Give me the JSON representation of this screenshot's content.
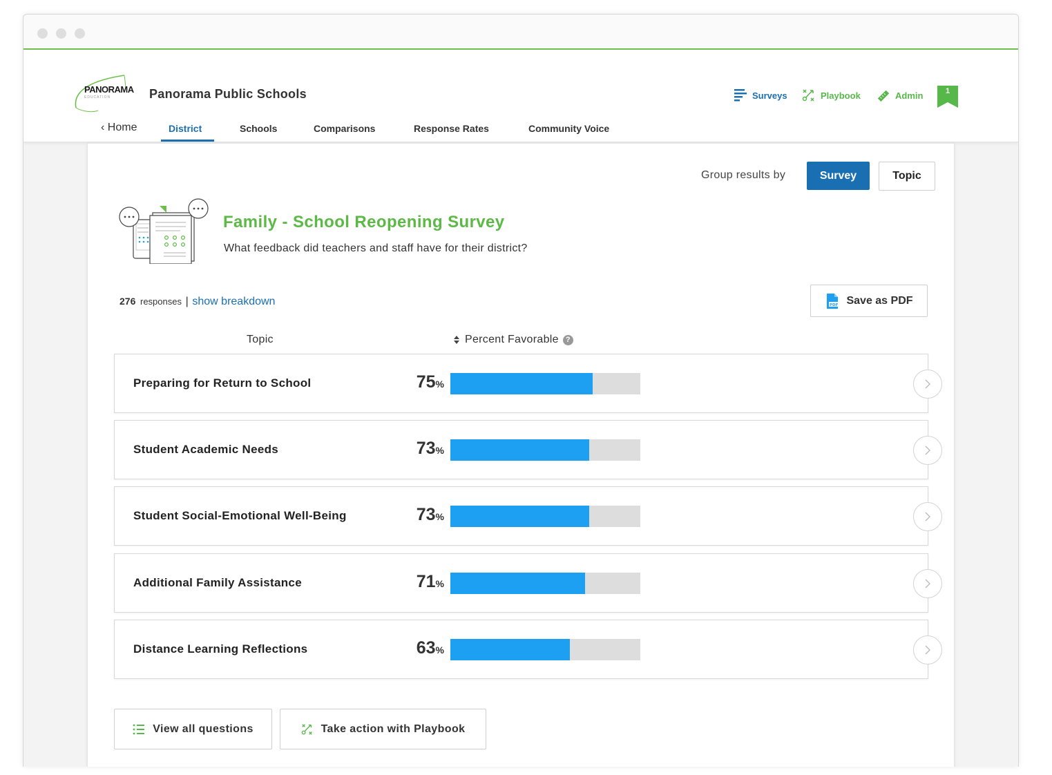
{
  "org": {
    "logo_text": "PANORAMA",
    "logo_sub": "EDUCATION",
    "name": "Panorama Public Schools"
  },
  "topnav": {
    "surveys": "Surveys",
    "playbook": "Playbook",
    "admin": "Admin",
    "notifications": "1"
  },
  "tabs": {
    "home": "Home",
    "district": "District",
    "schools": "Schools",
    "comparisons": "Comparisons",
    "response_rates": "Response Rates",
    "community_voice": "Community Voice"
  },
  "group": {
    "label": "Group results by",
    "survey": "Survey",
    "topic": "Topic"
  },
  "survey": {
    "title": "Family - School Reopening Survey",
    "question": "What feedback did teachers and staff have for their district?"
  },
  "responses": {
    "count": "276",
    "label": "responses",
    "separator": "|",
    "link": "show breakdown"
  },
  "save_pdf": "Save as PDF",
  "columns": {
    "topic": "Topic",
    "percent": "Percent Favorable",
    "help": "?"
  },
  "topics": [
    {
      "label": "Preparing for Return to School",
      "value": 75,
      "pct_text": "75"
    },
    {
      "label": "Student Academic Needs",
      "value": 73,
      "pct_text": "73"
    },
    {
      "label": "Student Social-Emotional Well-Being",
      "value": 73,
      "pct_text": "73"
    },
    {
      "label": "Additional Family Assistance",
      "value": 71,
      "pct_text": "71"
    },
    {
      "label": "Distance Learning Reflections",
      "value": 63,
      "pct_text": "63"
    }
  ],
  "pct_sign": "%",
  "actions": {
    "view_all": "View all questions",
    "playbook": "Take action with Playbook"
  },
  "colors": {
    "primary": "#1a6fb2",
    "green": "#5cb946",
    "bar": "#1ea0f2",
    "track": "#dddddd"
  }
}
